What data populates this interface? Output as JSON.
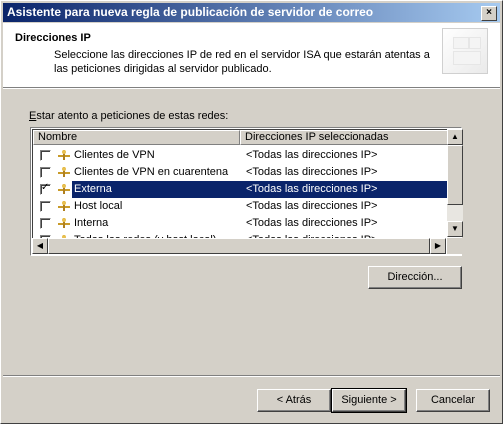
{
  "window": {
    "title": "Asistente para nueva regla de publicación de servidor de correo"
  },
  "header": {
    "title": "Direcciones IP",
    "description": "Seleccione las direcciones IP de red en el servidor ISA que estarán atentas a las peticiones dirigidas al servidor publicado."
  },
  "networks_label_prefix": "E",
  "networks_label_rest": "star atento a peticiones de estas redes:",
  "list": {
    "columns": [
      "Nombre",
      "Direcciones IP seleccionadas"
    ],
    "rows": [
      {
        "name": "Clientes de VPN",
        "ips": "<Todas las direcciones IP>",
        "checked": false,
        "selected": false
      },
      {
        "name": "Clientes de VPN en cuarentena",
        "ips": "<Todas las direcciones IP>",
        "checked": false,
        "selected": false
      },
      {
        "name": "Externa",
        "ips": "<Todas las direcciones IP>",
        "checked": true,
        "selected": true
      },
      {
        "name": "Host local",
        "ips": "<Todas las direcciones IP>",
        "checked": false,
        "selected": false
      },
      {
        "name": "Interna",
        "ips": "<Todas las direcciones IP>",
        "checked": false,
        "selected": false
      },
      {
        "name": "Todas las redes (y host local)",
        "ips": "<Todas las direcciones IP>",
        "checked": false,
        "selected": false
      }
    ]
  },
  "buttons": {
    "address": "Dirección...",
    "back": "< Atrás",
    "next": "Siguiente >",
    "cancel": "Cancelar"
  },
  "colors": {
    "selection": "#0a246a",
    "titlebar_start": "#0a246a",
    "titlebar_end": "#a6caf0"
  }
}
